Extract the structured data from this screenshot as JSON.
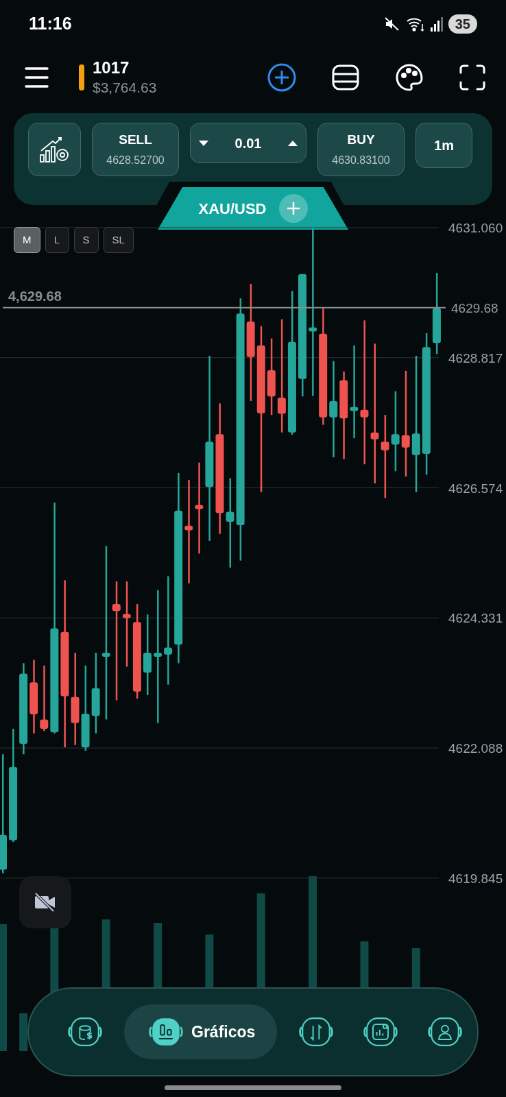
{
  "status_bar": {
    "time": "11:16",
    "battery": "35"
  },
  "header": {
    "account": "1017",
    "balance": "$3,764.63"
  },
  "trade_panel": {
    "sell": {
      "label": "SELL",
      "price": "4628.52700"
    },
    "lot": "0.01",
    "buy": {
      "label": "BUY",
      "price": "4630.83100"
    },
    "timeframe": "1m"
  },
  "symbol_tab": {
    "label": "XAU/USD"
  },
  "chart_modes": [
    {
      "label": "M",
      "selected": true
    },
    {
      "label": "L",
      "selected": false
    },
    {
      "label": "S",
      "selected": false
    },
    {
      "label": "SL",
      "selected": false
    }
  ],
  "price_line": {
    "left_label": "4,629.68",
    "right_label": "4629.68"
  },
  "price_axis": {
    "labels": [
      "4631.060",
      "4628.817",
      "4626.574",
      "4624.331",
      "4622.088",
      "4619.845"
    ]
  },
  "nav": {
    "items": [
      {
        "selected": false
      },
      {
        "selected": true,
        "label": "Gráficos"
      },
      {
        "selected": false
      },
      {
        "selected": false
      },
      {
        "selected": false
      }
    ]
  }
}
